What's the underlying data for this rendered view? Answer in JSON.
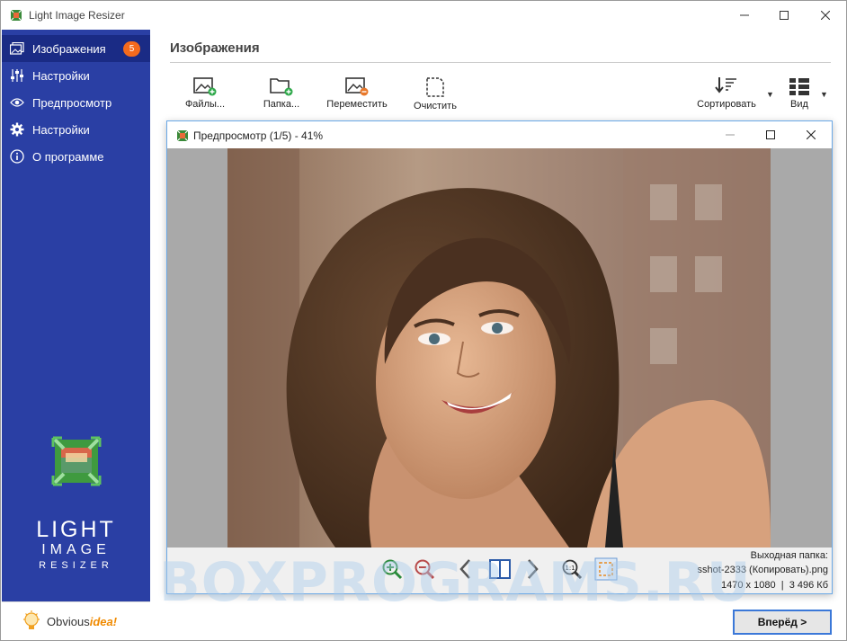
{
  "app": {
    "title": "Light Image Resizer"
  },
  "sidebar": {
    "items": [
      {
        "label": "Изображения",
        "icon": "images-icon",
        "active": true,
        "badge": "5"
      },
      {
        "label": "Настройки",
        "icon": "sliders-icon"
      },
      {
        "label": "Предпросмотр",
        "icon": "eye-icon"
      },
      {
        "label": "Настройки",
        "icon": "gear-icon"
      },
      {
        "label": "О программе",
        "icon": "info-icon"
      }
    ],
    "logo": {
      "line1": "LIGHT",
      "line2": "IMAGE",
      "line3": "RESIZER"
    },
    "footer": {
      "brand_part1": "Obvious",
      "brand_part2": "idea!"
    }
  },
  "main": {
    "title": "Изображения",
    "toolbar": {
      "files_label": "Файлы...",
      "folder_label": "Папка...",
      "move_label": "Переместить",
      "clear_label": "Очистить",
      "sort_label": "Сортировать",
      "view_label": "Вид"
    }
  },
  "preview": {
    "title": "Предпросмотр (1/5) - 41%",
    "output_folder_label": "Выходная папка:",
    "filename": "sshot-2333 (Копировать).png",
    "dimensions": "1470 x 1080",
    "separator": "|",
    "size": "3 496 Кб"
  },
  "watermark": "BOXPROGRAMS.RU",
  "buttons": {
    "next": "Вперёд >"
  },
  "colors": {
    "sidebar": "#2a3fa4",
    "sidebar_active": "#1a2b85",
    "badge": "#f36a1d",
    "accent": "#3b78d8"
  }
}
